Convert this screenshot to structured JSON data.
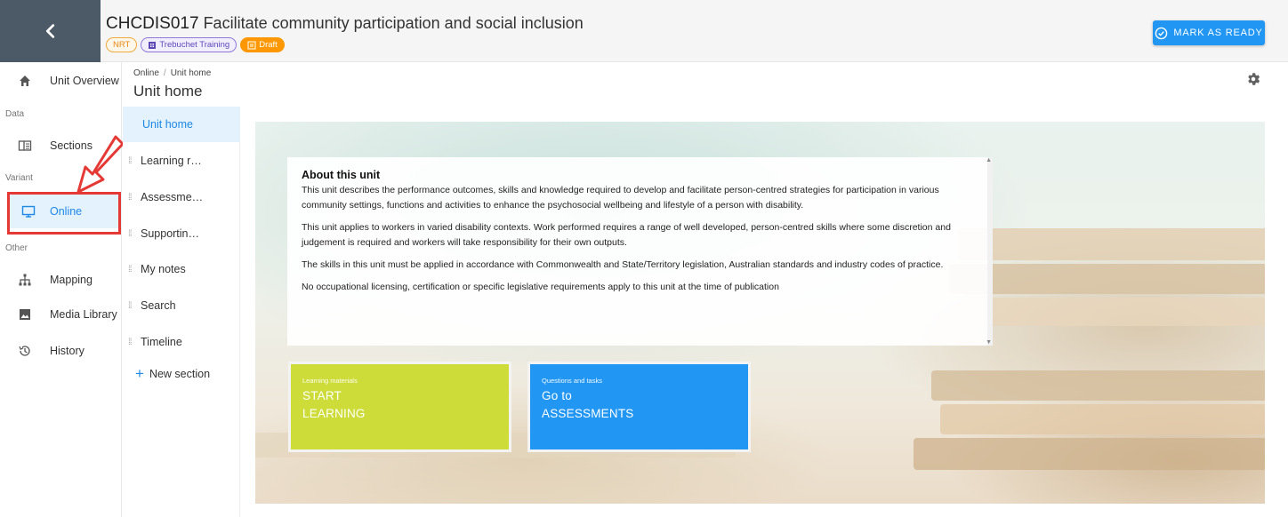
{
  "header": {
    "unit_code": "CHCDIS017",
    "unit_name": "Facilitate community participation and social inclusion",
    "chips": {
      "nrt": "NRT",
      "org": "Trebuchet Training",
      "status": "Draft"
    },
    "mark_ready_label": "MARK AS READY"
  },
  "leftnav": {
    "overview": "Unit Overview",
    "group_data": "Data",
    "sections": "Sections",
    "group_variant": "Variant",
    "online": "Online",
    "group_other": "Other",
    "mapping": "Mapping",
    "media_library": "Media Library",
    "history": "History"
  },
  "breadcrumb": {
    "root": "Online",
    "sep": "/",
    "current": "Unit home"
  },
  "page_title": "Unit home",
  "sections": {
    "items": [
      "Unit home",
      "Learning r…",
      "Assessme…",
      "Supportin…",
      "My notes",
      "Search",
      "Timeline"
    ],
    "new_section": "New section"
  },
  "about": {
    "title": "About this unit",
    "paragraphs": [
      "This unit describes the performance outcomes, skills and knowledge required to develop and facilitate person-centred strategies for participation in various community settings, functions and activities to enhance the psychosocial wellbeing and lifestyle of a person with disability.",
      "This unit applies to workers in varied disability contexts. Work performed requires a range of well developed, person-centred skills where some discretion and judgement is required and workers will take responsibility for their own outputs.",
      "The skills in this unit must be applied in accordance with Commonwealth and State/Territory legislation, Australian standards and industry codes of practice.",
      "No occupational licensing, certification or specific legislative requirements apply to this unit at the time of publication"
    ]
  },
  "tiles": {
    "learn": {
      "caption": "Learning materials",
      "line1": "START",
      "line2": "LEARNING",
      "color": "#cddc39"
    },
    "assess": {
      "caption": "Questions and tasks",
      "line1": "Go to",
      "line2": "ASSESSMENTS",
      "color": "#2196f3"
    }
  },
  "colors": {
    "accent": "#2196f3",
    "highlight": "#e53935",
    "nav_dark": "#4b5a66"
  }
}
